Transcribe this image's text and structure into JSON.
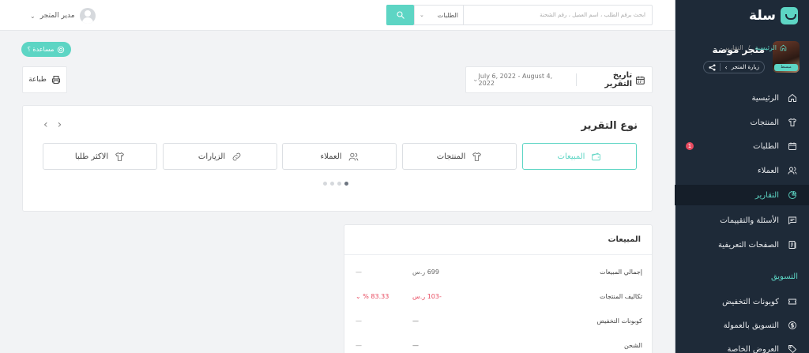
{
  "colors": {
    "accent": "#5dd5c4",
    "sidebar_bg": "#1e2a38",
    "danger": "#e84a5f",
    "page_bg": "#f2f3f5"
  },
  "sidebar": {
    "logo_text": "سلة",
    "store_name": "متجر موضة",
    "store_avatar_badge": "مبسط",
    "visit_store_label": "زيارة المتجر",
    "items": [
      {
        "label": "الرئيسية",
        "icon": "home-icon"
      },
      {
        "label": "المنتجات",
        "icon": "shirt-icon"
      },
      {
        "label": "الطلبات",
        "icon": "calendar-icon",
        "badge": "1"
      },
      {
        "label": "العملاء",
        "icon": "users-icon"
      },
      {
        "label": "التقارير",
        "icon": "pie-chart-icon",
        "active": true
      },
      {
        "label": "الأسئلة والتقييمات",
        "icon": "message-icon"
      },
      {
        "label": "الصفحات التعريفية",
        "icon": "pages-icon"
      }
    ],
    "marketing_heading": "التسويق",
    "marketing_items": [
      {
        "label": "كوبونات التخفيض",
        "icon": "ticket-icon"
      },
      {
        "label": "التسويق بالعمولة",
        "icon": "dollar-icon"
      },
      {
        "label": "العروض الخاصة",
        "icon": "tag-icon"
      }
    ]
  },
  "topbar": {
    "search_placeholder": "ابحث برقم الطلب ، اسم العميل ، رقم الشحنة",
    "search_scope": "الطلبات",
    "user_name": "مدير المتجر"
  },
  "breadcrumb": {
    "home": "الرئيسية",
    "separator": "/",
    "current": "التقارير"
  },
  "help_label": "مساعدة ؟",
  "print_label": "طباعة",
  "date_filter": {
    "label": "تاريخ التقرير",
    "range": "July 6, 2022 - August 4, 2022"
  },
  "report_type": {
    "title": "نوع التقرير",
    "types": [
      {
        "label": "المبيعات",
        "icon": "wallet-icon"
      },
      {
        "label": "المنتجات",
        "icon": "shirt-icon"
      },
      {
        "label": "العملاء",
        "icon": "users-icon"
      },
      {
        "label": "الزيارات",
        "icon": "link-icon"
      },
      {
        "label": "الاكثر طلبا",
        "icon": "shirt-icon"
      }
    ]
  },
  "sales_summary": {
    "title": "المبيعات",
    "rows": [
      {
        "label": "إجمالي المبيعات",
        "value": "699 ر.س",
        "change": "—"
      },
      {
        "label": "تكاليف المنتجات",
        "value": "-103 ر.س",
        "change": "% 83.33",
        "change_dir": "down"
      },
      {
        "label": "كوبونات التخفيض",
        "value": "—",
        "change": "—"
      },
      {
        "label": "الشحن",
        "value": "—",
        "change": "—"
      }
    ]
  }
}
